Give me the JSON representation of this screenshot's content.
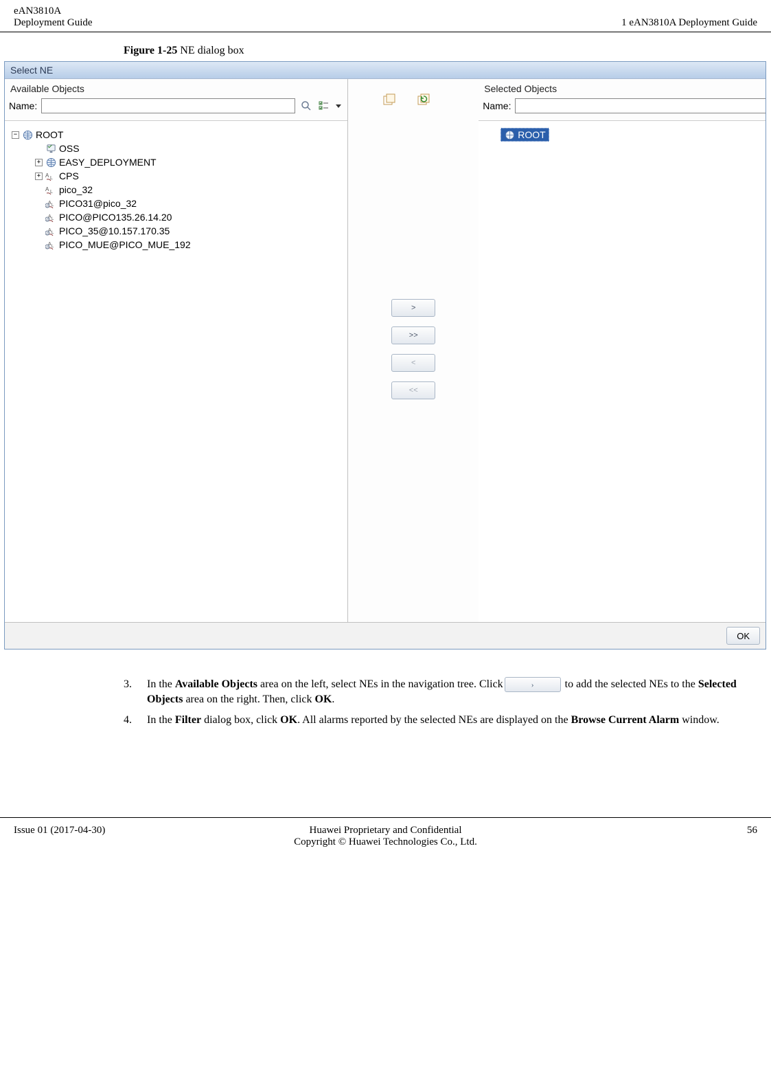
{
  "header": {
    "product": "eAN3810A",
    "doc_title": "Deployment Guide",
    "section_title": "1 eAN3810A Deployment Guide"
  },
  "figure": {
    "label": "Figure 1-25",
    "caption": "NE dialog box"
  },
  "dialog": {
    "title": "Select NE",
    "available_label": "Available Objects",
    "selected_label": "Selected Objects",
    "name_label": "Name:",
    "name_value": "",
    "name_value_right": "",
    "tree": {
      "root": "ROOT",
      "items": [
        {
          "label": "OSS",
          "icon": "monitor",
          "expand": ""
        },
        {
          "label": "EASY_DEPLOYMENT",
          "icon": "globe",
          "expand": "+"
        },
        {
          "label": "CPS",
          "icon": "al",
          "expand": "+"
        },
        {
          "label": "pico_32",
          "icon": "al",
          "expand": ""
        },
        {
          "label": "PICO31@pico_32",
          "icon": "al-at",
          "expand": ""
        },
        {
          "label": "PICO@PICO135.26.14.20",
          "icon": "al-at",
          "expand": ""
        },
        {
          "label": "PICO_35@10.157.170.35",
          "icon": "al-at",
          "expand": ""
        },
        {
          "label": "PICO_MUE@PICO_MUE_192",
          "icon": "al-at",
          "expand": ""
        }
      ]
    },
    "selected_root": "ROOT",
    "move_buttons": {
      "add_one": ">",
      "add_all": ">>",
      "remove_one": "<",
      "remove_all": "<<"
    },
    "ok_label": "OK"
  },
  "steps": {
    "s3_num": "3.",
    "s3_a": "In the ",
    "s3_b": "Available Objects",
    "s3_c": " area on the left, select NEs in the navigation tree. Click",
    "s3_d": " to add the selected NEs to the ",
    "s3_e": "Selected Objects",
    "s3_f": " area on the right. Then, click ",
    "s3_g": "OK",
    "s3_h": ".",
    "s4_num": "4.",
    "s4_a": "In the ",
    "s4_b": "Filter",
    "s4_c": " dialog box, click ",
    "s4_d": "OK",
    "s4_e": ". All alarms reported by the selected NEs are displayed on the ",
    "s4_f": "Browse Current Alarm",
    "s4_g": " window."
  },
  "footer": {
    "issue": "Issue 01 (2017-04-30)",
    "line1": "Huawei Proprietary and Confidential",
    "line2": "Copyright © Huawei Technologies Co., Ltd.",
    "page": "56"
  }
}
